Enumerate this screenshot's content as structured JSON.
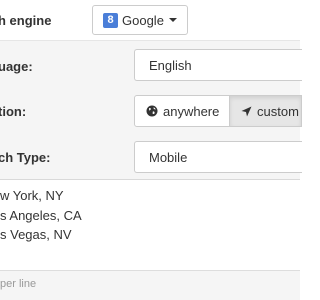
{
  "search_engine": {
    "label": "h engine",
    "button_label": "Google",
    "icon": "google-g-icon",
    "icon_glyph": "8"
  },
  "language": {
    "label": "uage:",
    "value": "English"
  },
  "location": {
    "label": "tion:",
    "options": [
      {
        "label": "anywhere",
        "icon": "globe-icon",
        "selected": false
      },
      {
        "label": "custom",
        "icon": "location-arrow-icon",
        "selected": true
      }
    ]
  },
  "search_type": {
    "label": "ch Type:",
    "value": "Mobile"
  },
  "locations_list": {
    "lines": [
      "w York, NY",
      "s Angeles, CA",
      "s Vegas, NV"
    ]
  },
  "hint": {
    "text": "per line"
  },
  "colors": {
    "panel_bg": "#f5f5f5",
    "google_icon_bg": "#4a7ed8",
    "active_segment_bg": "#e6e6e6"
  }
}
